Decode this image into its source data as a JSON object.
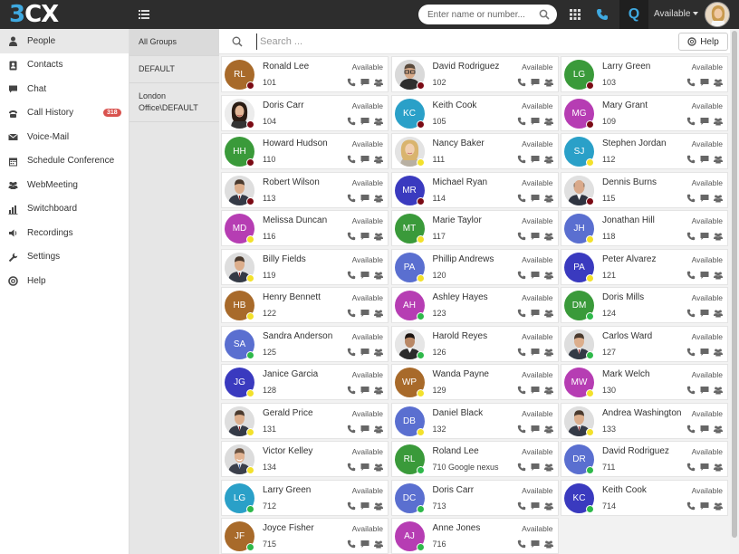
{
  "app": {
    "logo_prefix": "3",
    "logo_suffix": "CX"
  },
  "topbar": {
    "search_placeholder": "Enter name or number...",
    "q_label": "Q",
    "status_label": "Available"
  },
  "colors": {
    "topbar": "#2d2d2d",
    "accent": "#3fa9e0",
    "status_red": "#7a0a14",
    "status_yellow": "#f3e12b",
    "status_green": "#2eb84a",
    "badge": "#d9534f"
  },
  "sidebar": {
    "items": [
      {
        "label": "People",
        "icon": "person-icon"
      },
      {
        "label": "Contacts",
        "icon": "contact-book-icon"
      },
      {
        "label": "Chat",
        "icon": "chat-bubble-icon"
      },
      {
        "label": "Call History",
        "icon": "phone-icon",
        "badge": "318"
      },
      {
        "label": "Voice-Mail",
        "icon": "envelope-icon"
      },
      {
        "label": "Schedule Conference",
        "icon": "calendar-icon"
      },
      {
        "label": "WebMeeting",
        "icon": "group-icon"
      },
      {
        "label": "Switchboard",
        "icon": "bar-chart-icon"
      },
      {
        "label": "Recordings",
        "icon": "speaker-icon"
      },
      {
        "label": "Settings",
        "icon": "wrench-icon"
      },
      {
        "label": "Help",
        "icon": "lifebuoy-icon"
      }
    ]
  },
  "groups": {
    "items": [
      {
        "label": "All Groups"
      },
      {
        "label": "DEFAULT"
      },
      {
        "label": "London Office\\DEFAULT"
      }
    ]
  },
  "main": {
    "search_placeholder": "Search ...",
    "help_label": "Help"
  },
  "contacts": [
    {
      "name": "Ronald Lee",
      "ext": "101",
      "status": "Available",
      "initials": "RL",
      "color": "#a86a2a",
      "presence": "red"
    },
    {
      "name": "David Rodriguez",
      "ext": "102",
      "status": "Available",
      "initials": "",
      "color": "#cfcfcf",
      "presence": "red",
      "photo": "man-glasses"
    },
    {
      "name": "Larry Green",
      "ext": "103",
      "status": "Available",
      "initials": "LG",
      "color": "#3a9a3a",
      "presence": "red"
    },
    {
      "name": "Doris Carr",
      "ext": "104",
      "status": "Available",
      "initials": "",
      "color": "#cfcfcf",
      "presence": "red",
      "photo": "woman-dark"
    },
    {
      "name": "Keith Cook",
      "ext": "105",
      "status": "Available",
      "initials": "KC",
      "color": "#2aa0c8",
      "presence": "red"
    },
    {
      "name": "Mary Grant",
      "ext": "109",
      "status": "Available",
      "initials": "MG",
      "color": "#b63db3",
      "presence": "red"
    },
    {
      "name": "Howard Hudson",
      "ext": "110",
      "status": "Available",
      "initials": "HH",
      "color": "#3a9a3a",
      "presence": "red"
    },
    {
      "name": "Nancy Baker",
      "ext": "111",
      "status": "Available",
      "initials": "",
      "color": "#cfcfcf",
      "presence": "yellow",
      "photo": "woman-blonde"
    },
    {
      "name": "Stephen Jordan",
      "ext": "112",
      "status": "Available",
      "initials": "SJ",
      "color": "#2aa0c8",
      "presence": "yellow"
    },
    {
      "name": "Robert Wilson",
      "ext": "113",
      "status": "Available",
      "initials": "",
      "color": "#cfcfcf",
      "presence": "red",
      "photo": "man-suit"
    },
    {
      "name": "Michael Ryan",
      "ext": "114",
      "status": "Available",
      "initials": "MR",
      "color": "#3a3abf",
      "presence": "red"
    },
    {
      "name": "Dennis Burns",
      "ext": "115",
      "status": "Available",
      "initials": "",
      "color": "#cfcfcf",
      "presence": "red",
      "photo": "man-bald"
    },
    {
      "name": "Melissa Duncan",
      "ext": "116",
      "status": "Available",
      "initials": "MD",
      "color": "#b63db3",
      "presence": "yellow"
    },
    {
      "name": "Marie Taylor",
      "ext": "117",
      "status": "Available",
      "initials": "MT",
      "color": "#3a9a3a",
      "presence": "yellow"
    },
    {
      "name": "Jonathan Hill",
      "ext": "118",
      "status": "Available",
      "initials": "JH",
      "color": "#5a6fd0",
      "presence": "yellow"
    },
    {
      "name": "Billy Fields",
      "ext": "119",
      "status": "Available",
      "initials": "",
      "color": "#cfcfcf",
      "presence": "yellow",
      "photo": "man-suit"
    },
    {
      "name": "Phillip Andrews",
      "ext": "120",
      "status": "Available",
      "initials": "PA",
      "color": "#5a6fd0",
      "presence": "yellow"
    },
    {
      "name": "Peter Alvarez",
      "ext": "121",
      "status": "Available",
      "initials": "PA",
      "color": "#3a3abf",
      "presence": "yellow"
    },
    {
      "name": "Henry Bennett",
      "ext": "122",
      "status": "Available",
      "initials": "HB",
      "color": "#a86a2a",
      "presence": "yellow"
    },
    {
      "name": "Ashley Hayes",
      "ext": "123",
      "status": "Available",
      "initials": "AH",
      "color": "#b63db3",
      "presence": "green"
    },
    {
      "name": "Doris Mills",
      "ext": "124",
      "status": "Available",
      "initials": "DM",
      "color": "#3a9a3a",
      "presence": "green"
    },
    {
      "name": "Sandra Anderson",
      "ext": "125",
      "status": "Available",
      "initials": "SA",
      "color": "#5a6fd0",
      "presence": "green"
    },
    {
      "name": "Harold Reyes",
      "ext": "126",
      "status": "Available",
      "initials": "",
      "color": "#cfcfcf",
      "presence": "green",
      "photo": "man-dark"
    },
    {
      "name": "Carlos Ward",
      "ext": "127",
      "status": "Available",
      "initials": "",
      "color": "#cfcfcf",
      "presence": "green",
      "photo": "man-suit"
    },
    {
      "name": "Janice Garcia",
      "ext": "128",
      "status": "Available",
      "initials": "JG",
      "color": "#3a3abf",
      "presence": "yellow"
    },
    {
      "name": "Wanda Payne",
      "ext": "129",
      "status": "Available",
      "initials": "WP",
      "color": "#a86a2a",
      "presence": "yellow"
    },
    {
      "name": "Mark Welch",
      "ext": "130",
      "status": "Available",
      "initials": "MW",
      "color": "#b63db3",
      "presence": "yellow"
    },
    {
      "name": "Gerald Price",
      "ext": "131",
      "status": "Available",
      "initials": "",
      "color": "#cfcfcf",
      "presence": "yellow",
      "photo": "man-suit"
    },
    {
      "name": "Daniel Black",
      "ext": "132",
      "status": "Available",
      "initials": "DB",
      "color": "#5a6fd0",
      "presence": "yellow"
    },
    {
      "name": "Andrea Washington",
      "ext": "133",
      "status": "Available",
      "initials": "",
      "color": "#cfcfcf",
      "presence": "yellow",
      "photo": "man-suit"
    },
    {
      "name": "Victor Kelley",
      "ext": "134",
      "status": "Available",
      "initials": "",
      "color": "#cfcfcf",
      "presence": "yellow",
      "photo": "man-smile"
    },
    {
      "name": "Roland Lee",
      "ext": "710 Google nexus",
      "status": "Available",
      "initials": "RL",
      "color": "#3a9a3a",
      "presence": "green"
    },
    {
      "name": "David Rodriguez",
      "ext": "711",
      "status": "Available",
      "initials": "DR",
      "color": "#5a6fd0",
      "presence": "green"
    },
    {
      "name": "Larry Green",
      "ext": "712",
      "status": "Available",
      "initials": "LG",
      "color": "#2aa0c8",
      "presence": "green"
    },
    {
      "name": "Doris Carr",
      "ext": "713",
      "status": "Available",
      "initials": "DC",
      "color": "#5a6fd0",
      "presence": "green"
    },
    {
      "name": "Keith Cook",
      "ext": "714",
      "status": "Available",
      "initials": "KC",
      "color": "#3a3abf",
      "presence": "green"
    },
    {
      "name": "Joyce Fisher",
      "ext": "715",
      "status": "Available",
      "initials": "JF",
      "color": "#a86a2a",
      "presence": "green"
    },
    {
      "name": "Anne Jones",
      "ext": "716",
      "status": "Available",
      "initials": "AJ",
      "color": "#b63db3",
      "presence": "green"
    }
  ]
}
